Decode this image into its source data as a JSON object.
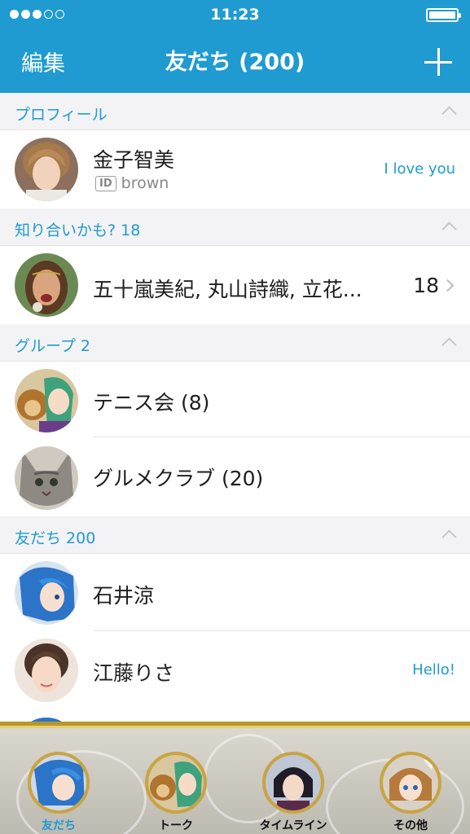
{
  "status_bar": {
    "time": "11:23",
    "signal_dots_filled": 3,
    "signal_dots_total": 5,
    "battery_level": 1.0
  },
  "nav": {
    "edit_label": "編集",
    "title": "友だち (200)",
    "add_icon": "plus-icon"
  },
  "sections": {
    "profile": {
      "title": "プロフィール"
    },
    "suggested": {
      "title": "知り合いかも? 18"
    },
    "groups": {
      "title": "グループ 2"
    },
    "friends": {
      "title": "友だち 200"
    }
  },
  "profile": {
    "name": "金子智美",
    "id_badge": "ID",
    "id_value": "brown",
    "status_message": "I love you"
  },
  "suggested": {
    "names": "五十嵐美紀, 丸山詩織, 立花...",
    "count": "18"
  },
  "groups": [
    {
      "name": "テニス会 (8)"
    },
    {
      "name": "グルメクラブ (20)"
    }
  ],
  "friends": [
    {
      "name": "石井涼",
      "status_message": ""
    },
    {
      "name": "江藤りさ",
      "status_message": "Hello!"
    }
  ],
  "tabs": [
    {
      "label": "友だち",
      "active": true
    },
    {
      "label": "トーク",
      "active": false
    },
    {
      "label": "タイムライン",
      "active": false
    },
    {
      "label": "その他",
      "active": false
    }
  ],
  "colors": {
    "accent": "#1f9bd1",
    "tab_border_gold": "#b8962c"
  }
}
